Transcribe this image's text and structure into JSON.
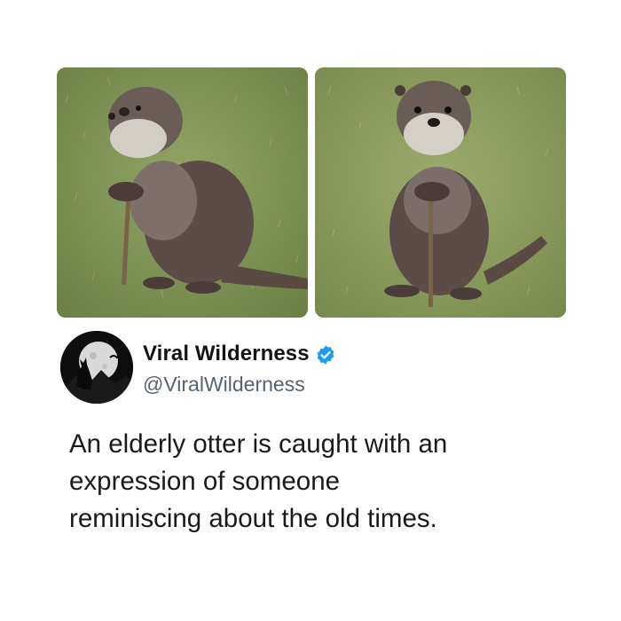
{
  "post": {
    "images": [
      {
        "description_icon": "otter-leaning-on-stick-side-view",
        "grass_color": "#7d9154"
      },
      {
        "description_icon": "otter-standing-with-stick-front-view",
        "grass_color": "#8a9a5c"
      }
    ],
    "author": {
      "display_name": "Viral Wilderness",
      "handle": "@ViralWilderness",
      "avatar_icon": "howling-wolf-moon-icon",
      "verified_icon": "verified-badge-icon",
      "verified_color": "#1d9bf0"
    },
    "text_lines": [
      "An elderly otter is caught with an",
      "expression of someone",
      "reminiscing about the old times."
    ]
  }
}
